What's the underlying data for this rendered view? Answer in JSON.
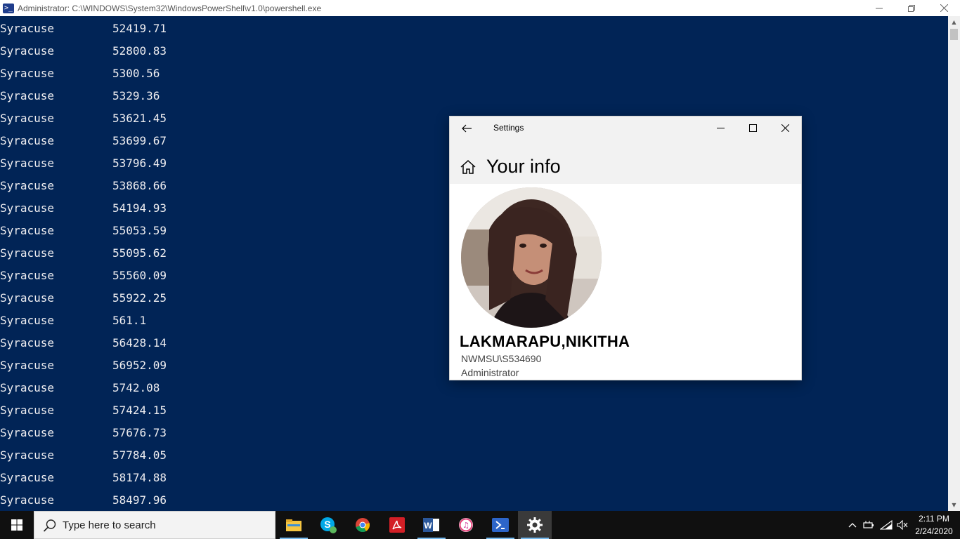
{
  "powershell": {
    "title": "Administrator: C:\\WINDOWS\\System32\\WindowsPowerShell\\v1.0\\powershell.exe",
    "icon": "powershell-icon",
    "rows": [
      {
        "city": "Syracuse",
        "value": "52419.71"
      },
      {
        "city": "Syracuse",
        "value": "52800.83"
      },
      {
        "city": "Syracuse",
        "value": "5300.56"
      },
      {
        "city": "Syracuse",
        "value": "5329.36"
      },
      {
        "city": "Syracuse",
        "value": "53621.45"
      },
      {
        "city": "Syracuse",
        "value": "53699.67"
      },
      {
        "city": "Syracuse",
        "value": "53796.49"
      },
      {
        "city": "Syracuse",
        "value": "53868.66"
      },
      {
        "city": "Syracuse",
        "value": "54194.93"
      },
      {
        "city": "Syracuse",
        "value": "55053.59"
      },
      {
        "city": "Syracuse",
        "value": "55095.62"
      },
      {
        "city": "Syracuse",
        "value": "55560.09"
      },
      {
        "city": "Syracuse",
        "value": "55922.25"
      },
      {
        "city": "Syracuse",
        "value": "561.1"
      },
      {
        "city": "Syracuse",
        "value": "56428.14"
      },
      {
        "city": "Syracuse",
        "value": "56952.09"
      },
      {
        "city": "Syracuse",
        "value": "5742.08"
      },
      {
        "city": "Syracuse",
        "value": "57424.15"
      },
      {
        "city": "Syracuse",
        "value": "57676.73"
      },
      {
        "city": "Syracuse",
        "value": "57784.05"
      },
      {
        "city": "Syracuse",
        "value": "58174.88"
      },
      {
        "city": "Syracuse",
        "value": "58497.96"
      }
    ]
  },
  "settings": {
    "caption": "Settings",
    "heading": "Your info",
    "user_name": "LAKMARAPU,NIKITHA",
    "account": "NWMSU\\S534690",
    "role": "Administrator"
  },
  "taskbar": {
    "search_placeholder": "Type here to search",
    "apps": [
      "file-explorer",
      "skype",
      "chrome",
      "acrobat-reader",
      "word",
      "itunes",
      "powershell",
      "settings"
    ],
    "active_app": "settings",
    "time": "2:11 PM",
    "date": "2/24/2020"
  },
  "colors": {
    "console_bg": "#012456",
    "console_text": "#eeedf0",
    "taskbar_bg": "#101010",
    "accent": "#76b9ed"
  }
}
